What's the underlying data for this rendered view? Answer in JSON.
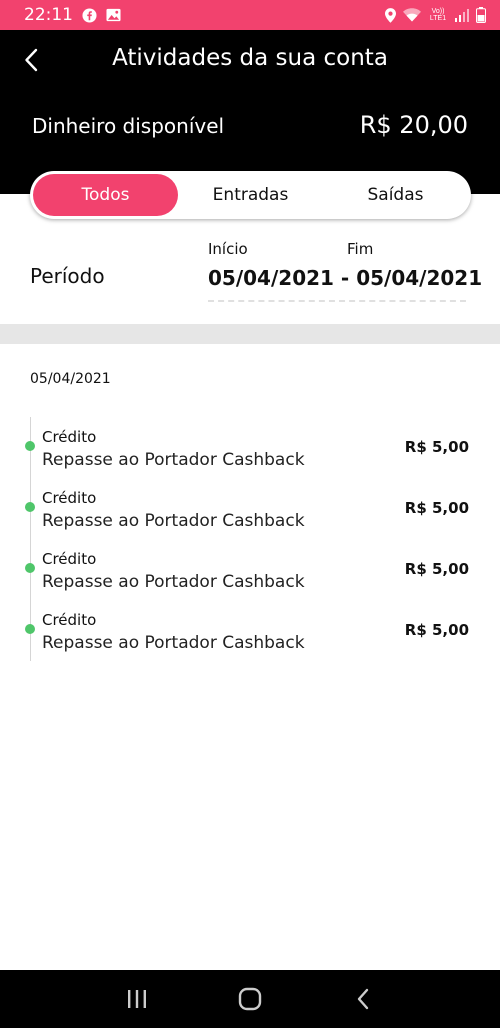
{
  "status_bar": {
    "time": "22:11",
    "network_label": "Vo)) LTE1"
  },
  "header": {
    "title": "Atividades da sua conta",
    "balance_label": "Dinheiro disponível",
    "balance_value": "R$ 20,00"
  },
  "tabs": [
    {
      "label": "Todos",
      "active": true
    },
    {
      "label": "Entradas",
      "active": false
    },
    {
      "label": "Saídas",
      "active": false
    }
  ],
  "period": {
    "label": "Período",
    "start_label": "Início",
    "end_label": "Fim",
    "start_date": "05/04/2021",
    "separator": "-",
    "end_date": "05/04/2021"
  },
  "group": {
    "date": "05/04/2021",
    "transactions": [
      {
        "type": "Crédito",
        "description": "Repasse ao Portador Cashback",
        "amount": "R$ 5,00"
      },
      {
        "type": "Crédito",
        "description": "Repasse ao Portador Cashback",
        "amount": "R$ 5,00"
      },
      {
        "type": "Crédito",
        "description": "Repasse ao Portador Cashback",
        "amount": "R$ 5,00"
      },
      {
        "type": "Crédito",
        "description": "Repasse ao Portador Cashback",
        "amount": "R$ 5,00"
      }
    ]
  },
  "colors": {
    "accent": "#f2426e",
    "header_bg": "#000000",
    "credit_dot": "#4fc66a"
  },
  "icons": {
    "status": [
      "facebook-icon",
      "gallery-icon",
      "location-icon",
      "wifi-icon",
      "signal-icon",
      "battery-icon"
    ],
    "back": "chevron-left-icon",
    "nav": [
      "recent-apps-icon",
      "home-icon",
      "back-icon"
    ]
  }
}
